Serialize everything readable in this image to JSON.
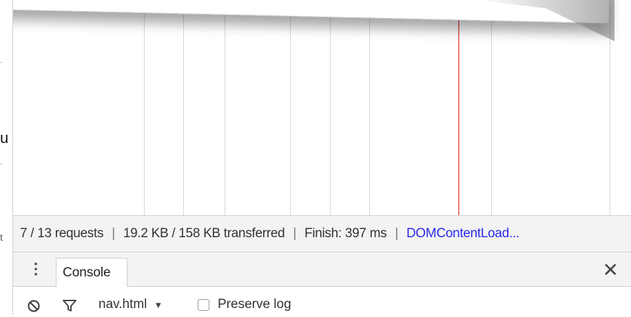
{
  "page_strip": {
    "chars": [
      "·",
      "u",
      "·",
      "t"
    ]
  },
  "summary": {
    "requests": "7 / 13 requests",
    "separator": "|",
    "transferred": "19.2 KB / 158 KB transferred",
    "finish": "Finish: 397 ms",
    "dom_content_loaded": "DOMContentLoad..."
  },
  "drawer": {
    "menu_icon": "⋮",
    "tab_console": "Console",
    "close_icon": "✕"
  },
  "console_toolbar": {
    "context": "nav.html",
    "context_arrow": "▼",
    "preserve_log": "Preserve log"
  },
  "colors": {
    "load_marker": "#ea7a7a",
    "link": "#2a2af0",
    "toolbar_bg": "#f3f3f3"
  }
}
